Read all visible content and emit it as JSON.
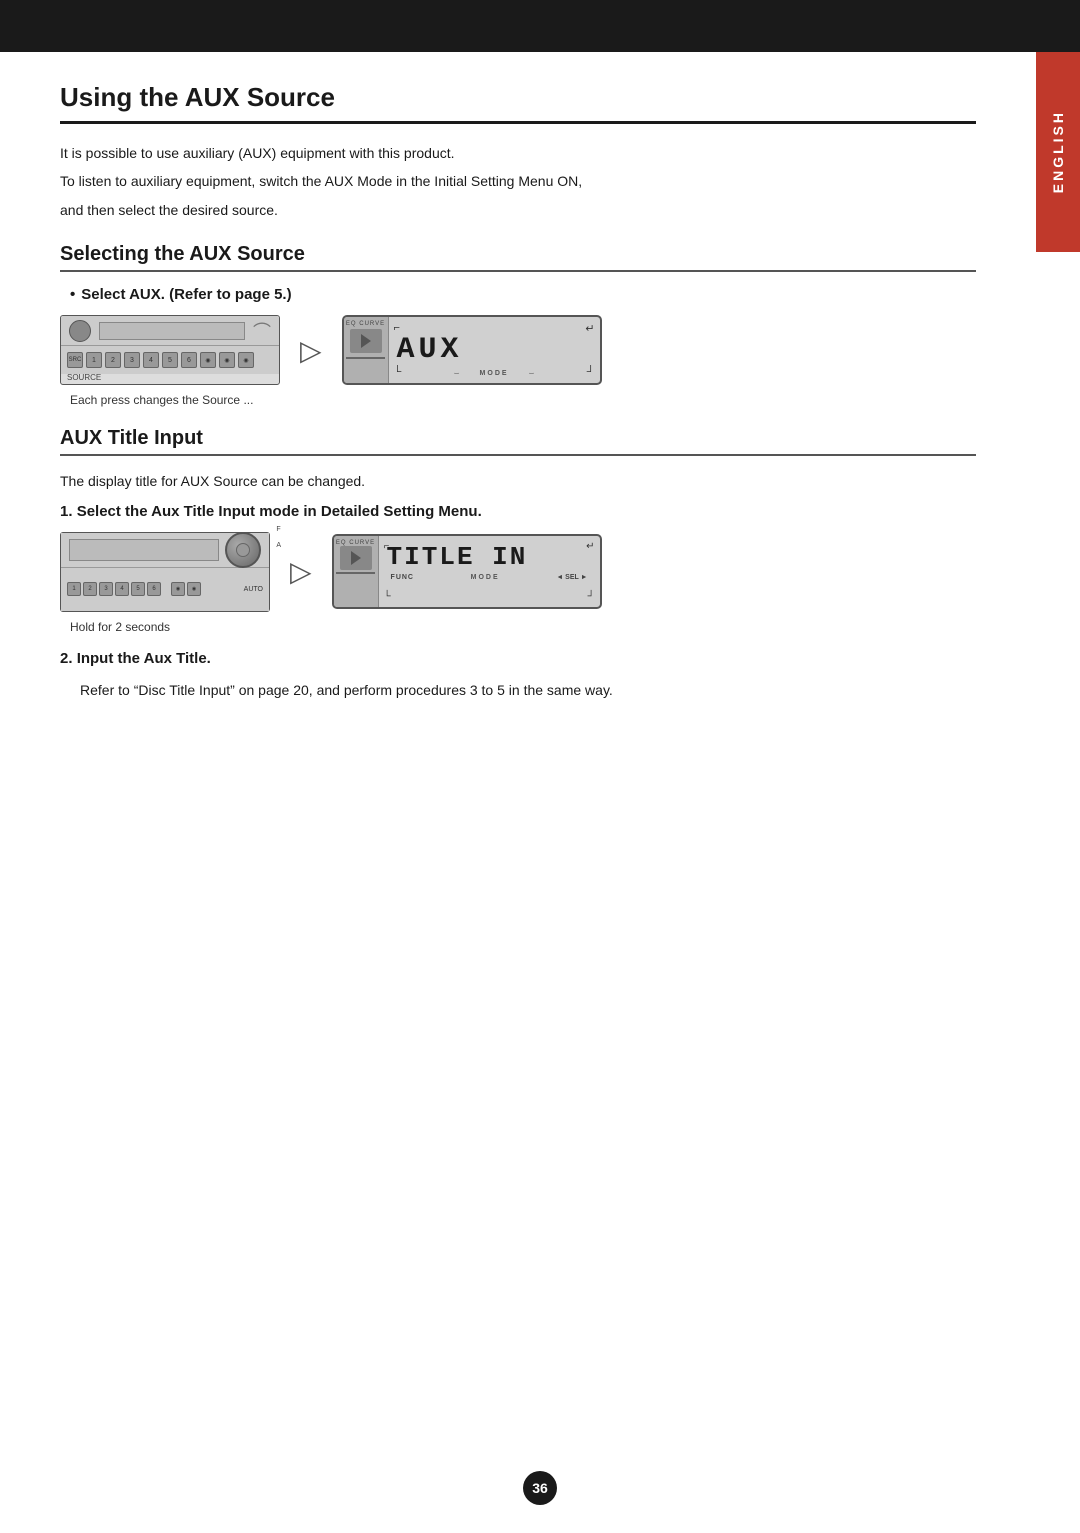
{
  "top_bar": {},
  "sidebar": {
    "label": "ENGLISH"
  },
  "page": {
    "title": "Using the AUX Source",
    "intro_lines": [
      "It is possible to use auxiliary (AUX) equipment with this product.",
      "To listen to auxiliary equipment, switch the AUX Mode in the Initial Setting Menu ON,",
      "and then select the desired source."
    ],
    "sections": [
      {
        "id": "selecting-aux",
        "heading": "Selecting the AUX Source",
        "bullet": "Select AUX. (Refer to page 5.)",
        "aux_display_text": "AUX",
        "caption": "Each press changes the Source ..."
      },
      {
        "id": "aux-title-input",
        "heading": "AUX Title Input",
        "intro": "The display title for AUX Source can be changed.",
        "steps": [
          {
            "num": "1.",
            "label": "Select the Aux Title Input mode in Detailed Setting Menu.",
            "display_text": "TITLE IN",
            "caption": "Hold for 2 seconds"
          },
          {
            "num": "2.",
            "label": "Input the Aux Title.",
            "body": "Refer to “Disc Title Input” on page 20, and perform procedures 3 to 5 in the same way."
          }
        ]
      }
    ],
    "page_number": "36",
    "eq_curve_label": "EQ CURVE",
    "mode_label": "MODE",
    "func_label": "FUNC",
    "sel_label": "◄ SEL ►"
  }
}
